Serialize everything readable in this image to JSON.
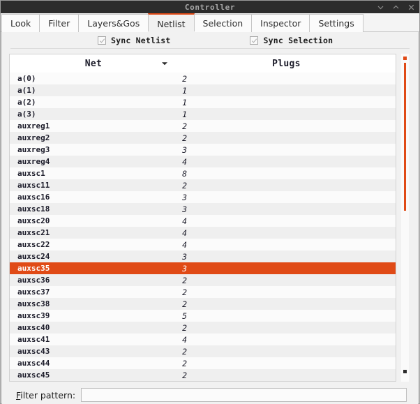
{
  "window": {
    "title": "Controller",
    "buttons": [
      {
        "name": "minimize-button",
        "icon": "chevron-down-icon"
      },
      {
        "name": "maximize-button",
        "icon": "chevron-up-icon"
      },
      {
        "name": "close-button",
        "icon": "close-icon"
      }
    ]
  },
  "tabs": [
    {
      "label": "Look",
      "active": false
    },
    {
      "label": "Filter",
      "active": false
    },
    {
      "label": "Layers&Gos",
      "active": false
    },
    {
      "label": "Netlist",
      "active": true
    },
    {
      "label": "Selection",
      "active": false
    },
    {
      "label": "Inspector",
      "active": false
    },
    {
      "label": "Settings",
      "active": false
    }
  ],
  "options": {
    "sync_netlist": {
      "label": "Sync Netlist",
      "checked": true
    },
    "sync_selection": {
      "label": "Sync Selection",
      "checked": true
    }
  },
  "table": {
    "columns": [
      {
        "key": "net",
        "label": "Net",
        "sorted": true,
        "sort_direction": "descending"
      },
      {
        "key": "plugs",
        "label": "Plugs",
        "sorted": false
      }
    ],
    "selected_row": "auxsc35",
    "rows": [
      {
        "net": "a(0)",
        "plugs": "2"
      },
      {
        "net": "a(1)",
        "plugs": "1"
      },
      {
        "net": "a(2)",
        "plugs": "1"
      },
      {
        "net": "a(3)",
        "plugs": "1"
      },
      {
        "net": "auxreg1",
        "plugs": "2"
      },
      {
        "net": "auxreg2",
        "plugs": "2"
      },
      {
        "net": "auxreg3",
        "plugs": "3"
      },
      {
        "net": "auxreg4",
        "plugs": "4"
      },
      {
        "net": "auxsc1",
        "plugs": "8"
      },
      {
        "net": "auxsc11",
        "plugs": "2"
      },
      {
        "net": "auxsc16",
        "plugs": "3"
      },
      {
        "net": "auxsc18",
        "plugs": "3"
      },
      {
        "net": "auxsc20",
        "plugs": "4"
      },
      {
        "net": "auxsc21",
        "plugs": "4"
      },
      {
        "net": "auxsc22",
        "plugs": "4"
      },
      {
        "net": "auxsc24",
        "plugs": "3"
      },
      {
        "net": "auxsc35",
        "plugs": "3"
      },
      {
        "net": "auxsc36",
        "plugs": "2"
      },
      {
        "net": "auxsc37",
        "plugs": "2"
      },
      {
        "net": "auxsc38",
        "plugs": "2"
      },
      {
        "net": "auxsc39",
        "plugs": "5"
      },
      {
        "net": "auxsc40",
        "plugs": "2"
      },
      {
        "net": "auxsc41",
        "plugs": "4"
      },
      {
        "net": "auxsc43",
        "plugs": "2"
      },
      {
        "net": "auxsc44",
        "plugs": "2"
      },
      {
        "net": "auxsc45",
        "plugs": "2"
      }
    ]
  },
  "scrollbar": {
    "up_arrow": "scroll-up-arrow",
    "down_arrow": "scroll-down-arrow"
  },
  "filter": {
    "label_prefix": "F",
    "label_rest": "ilter pattern:",
    "value": "",
    "placeholder": ""
  },
  "colors": {
    "accent": "#e04a16",
    "titlebar_bg": "#2c2c2c",
    "titlebar_text": "#a8a8a8",
    "panel_bg": "#f1f1f1",
    "row_bg": "#fbfbfb",
    "row_alt_bg": "#efefef"
  }
}
